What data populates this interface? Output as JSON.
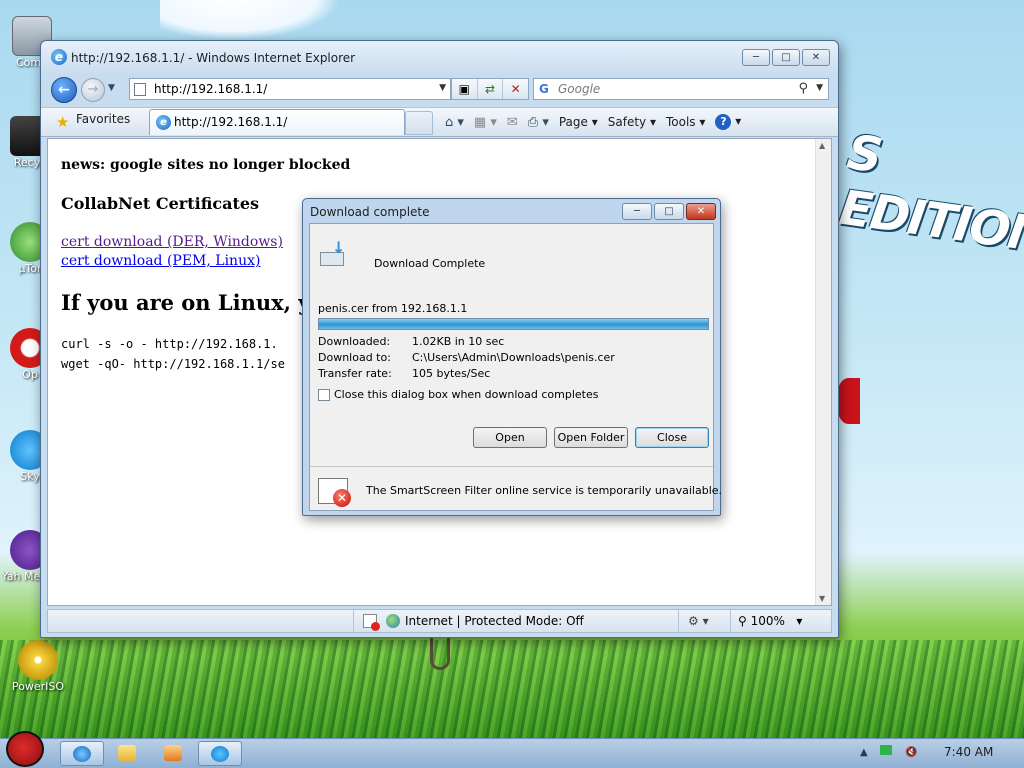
{
  "desktop": {
    "icons": [
      {
        "label": "Comp",
        "name": "computer"
      },
      {
        "label": "Recyc",
        "name": "recycle-bin"
      },
      {
        "label": "µTor",
        "name": "utorrent"
      },
      {
        "label": "Op",
        "name": "opera"
      },
      {
        "label": "Sky",
        "name": "skype"
      },
      {
        "label": "Yah Messe",
        "name": "yahoo-messenger"
      },
      {
        "label": "PowerISO",
        "name": "poweriso"
      }
    ],
    "wallpaper_text": "S EDITION"
  },
  "ie": {
    "title": "http://192.168.1.1/ - Windows Internet Explorer",
    "address": "http://192.168.1.1/",
    "search_placeholder": "Google",
    "favorites_label": "Favorites",
    "tab_title": "http://192.168.1.1/",
    "commands": {
      "page": "Page",
      "safety": "Safety",
      "tools": "Tools"
    },
    "status": {
      "zone": "Internet | Protected Mode: Off",
      "zoom": "100%"
    }
  },
  "page": {
    "news": "news: google sites no longer blocked",
    "certs_heading": "CollabNet Certificates",
    "link_der": "cert download (DER, Windows)",
    "link_pem": "cert download (PEM, Linux)",
    "linux_heading": "If you are on Linux, you",
    "code_curl": "curl -s -o - http://192.168.1.",
    "code_wget": "wget -qO- http://192.168.1.1/se"
  },
  "download_dialog": {
    "title": "Download complete",
    "heading": "Download Complete",
    "file_from": "penis.cer from 192.168.1.1",
    "progress_fraction": 1.0,
    "rows": [
      {
        "label": "Downloaded:",
        "value": "1.02KB in 10 sec"
      },
      {
        "label": "Download to:",
        "value": "C:\\Users\\Admin\\Downloads\\penis.cer"
      },
      {
        "label": "Transfer rate:",
        "value": "105 bytes/Sec"
      }
    ],
    "checkbox_label": "Close this dialog box when download completes",
    "checkbox_checked": false,
    "buttons": {
      "open": "Open",
      "open_folder": "Open Folder",
      "close": "Close"
    },
    "smartscreen": "The SmartScreen Filter online service is temporarily unavailable."
  },
  "taskbar": {
    "clock": "7:40 AM"
  }
}
